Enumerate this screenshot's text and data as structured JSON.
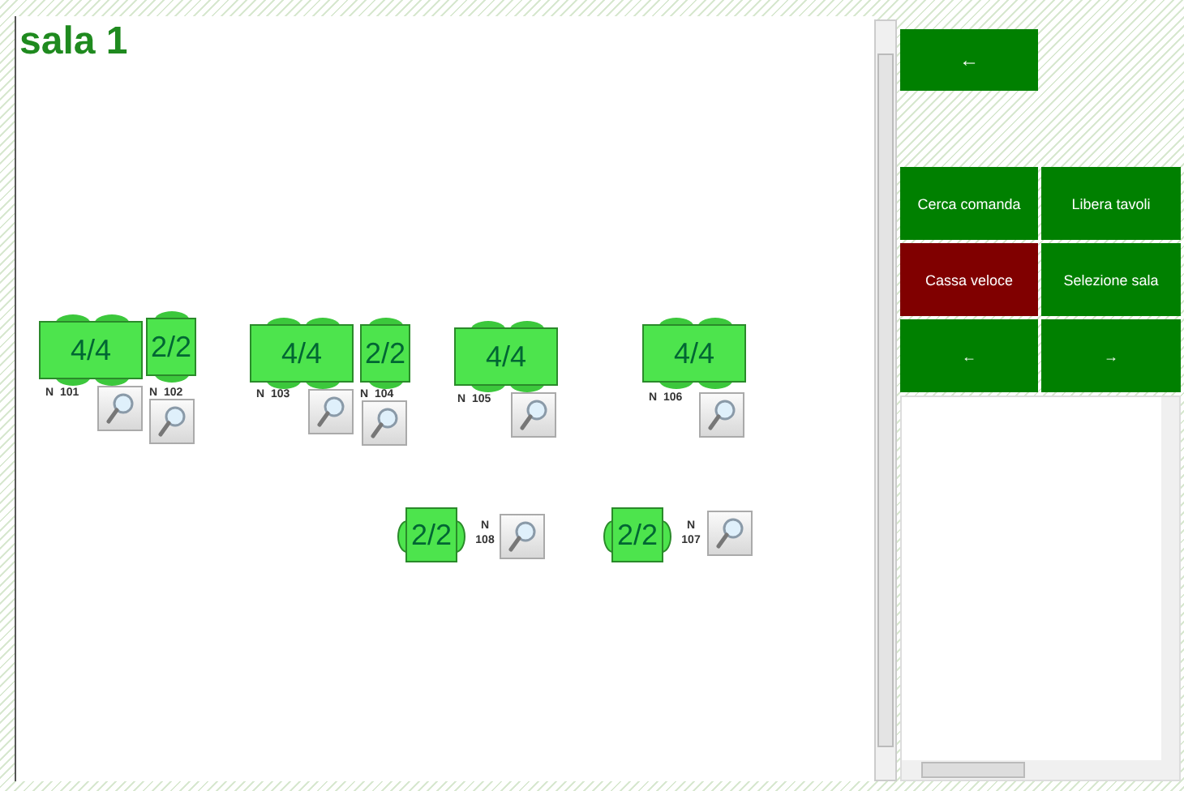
{
  "room": {
    "title": "sala 1"
  },
  "tables": [
    {
      "kind": "four",
      "seats": "4/4",
      "label": "N  101"
    },
    {
      "kind": "two",
      "seats": "2/2",
      "label": "N  102"
    },
    {
      "kind": "four",
      "seats": "4/4",
      "label": "N  103"
    },
    {
      "kind": "two",
      "seats": "2/2",
      "label": "N  104"
    },
    {
      "kind": "four",
      "seats": "4/4",
      "label": "N  105"
    },
    {
      "kind": "four",
      "seats": "4/4",
      "label": "N  106"
    },
    {
      "kind": "side",
      "seats": "2/2",
      "label": "N 108"
    },
    {
      "kind": "side",
      "seats": "2/2",
      "label": "N 107"
    }
  ],
  "side_panel": {
    "back_button": "←",
    "buttons": [
      {
        "label": "Cerca comanda",
        "color": "#008000"
      },
      {
        "label": "Libera tavoli",
        "color": "#008000"
      },
      {
        "label": "Cassa veloce",
        "color": "#800000"
      },
      {
        "label": "Selezione sala",
        "color": "#008000"
      },
      {
        "label": "←",
        "color": "#008000"
      },
      {
        "label": "→",
        "color": "#008000"
      }
    ]
  }
}
